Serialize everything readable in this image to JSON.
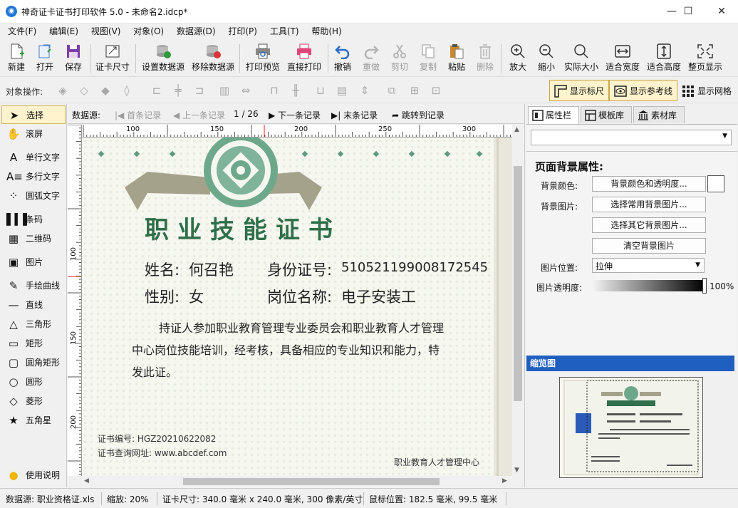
{
  "window": {
    "title": "神奇证卡证书打印软件 5.0 - 未命名2.idcp*",
    "minimize": "—",
    "maximize": "☐",
    "close": "✕"
  },
  "menu": [
    "文件(F)",
    "编辑(E)",
    "视图(V)",
    "对象(O)",
    "数据源(D)",
    "打印(P)",
    "工具(T)",
    "帮助(H)"
  ],
  "toolbar": {
    "new": "新建",
    "open": "打开",
    "save": "保存",
    "card_size": "证卡尺寸",
    "set_datasource": "设置数据源",
    "remove_datasource": "移除数据源",
    "print_preview": "打印预览",
    "direct_print": "直接打印",
    "undo": "撤销",
    "redo": "重做",
    "cut": "剪切",
    "copy": "复制",
    "paste": "粘贴",
    "delete": "删除",
    "zoom_in": "放大",
    "zoom_out": "缩小",
    "actual_size": "实际大小",
    "fit_width": "适合宽度",
    "fit_height": "适合高度",
    "fit_page": "整页显示"
  },
  "objbar": {
    "label": "对象操作:",
    "show_ruler": "显示标尺",
    "show_guides": "显示参考线",
    "show_grid": "显示网格"
  },
  "tools": [
    "选择",
    "滚屏",
    "单行文字",
    "多行文字",
    "圆弧文字",
    "条码",
    "二维码",
    "图片",
    "手绘曲线",
    "直线",
    "三角形",
    "矩形",
    "圆角矩形",
    "圆形",
    "菱形",
    "五角星",
    "使用说明"
  ],
  "navbar": {
    "label": "数据源:",
    "first": "首条记录",
    "prev": "上一条记录",
    "position": "1 / 26",
    "next": "下一条记录",
    "last": "末条记录",
    "jump": "跳转到记录"
  },
  "hruler_labels": [
    "100",
    "150",
    "200",
    "250",
    "300"
  ],
  "vruler_labels": [
    "100",
    "150",
    "200"
  ],
  "certificate": {
    "title": "职业技能证书",
    "name_label": "姓名:",
    "name_value": "何召艳",
    "id_label": "身份证号:",
    "id_value": "510521199008172545",
    "gender_label": "性别:",
    "gender_value": "女",
    "job_label": "岗位名称:",
    "job_value": "电子安装工",
    "body_line1": "持证人参加职业教育管理专业委员会和职业教育人才管理",
    "body_line2": "中心岗位技能培训，经考核，具备相应的专业知识和能力，特",
    "body_line3": "发此证。",
    "cert_no": "证书编号: HGZ20210622082",
    "query_url": "证书查询网址: www.abcdef.com",
    "issuer": "职业教育人才管理中心"
  },
  "rightpanel": {
    "tabs": [
      "属性栏",
      "模板库",
      "素材库"
    ],
    "section_title": "页面背景属性:",
    "bg_color_label": "背景颜色:",
    "bg_color_button": "背景颜色和透明度...",
    "bg_color_value": "#ffffff",
    "bg_image_label": "背景图片:",
    "select_common": "选择常用背景图片...",
    "select_other": "选择其它背景图片...",
    "clear_bg": "清空背景图片",
    "position_label": "图片位置:",
    "position_value": "拉伸",
    "opacity_label": "图片透明度:",
    "opacity_value": "100%",
    "thumbnail_header": "缩览图"
  },
  "status": {
    "datasource": "数据源: 职业资格证.xls",
    "zoom": "缩放: 20%",
    "card_size": "证卡尺寸: 340.0 毫米 x 240.0 毫米, 300 像素/英寸",
    "mouse_pos": "鼠标位置: 182.5 毫米, 99.5 毫米"
  },
  "colors": {
    "accent": "#1e78d7",
    "cert_green": "#2f6f4a",
    "selection": "#fff3cd",
    "thumb_header": "#1f5fbf"
  }
}
